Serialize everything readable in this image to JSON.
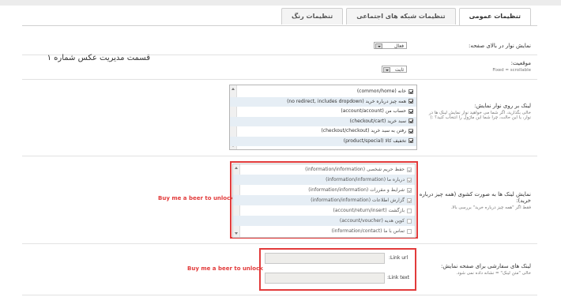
{
  "tabs": [
    {
      "label": "تنظیمات عمومی",
      "active": true
    },
    {
      "label": "تنظیمات شبکه های اجتماعی",
      "active": false
    },
    {
      "label": "تنظیمات رنگ",
      "active": false
    }
  ],
  "settings": {
    "show_bar": {
      "label": "نمایش نوار در بالای صفحه:",
      "value": "فعال"
    },
    "position": {
      "label": "موقعیت:",
      "hint": "Fixed = scrollable",
      "value": "ثابت"
    }
  },
  "heading": "قسمت مدیریت عکس شماره ۱",
  "links": {
    "label": "لینک بر روی نوار نمایش:",
    "hint": "خالی بگذارید، اگر شما می خواهید نوار نمایش لینک ها در نوار، یا این حالت، چرا شما این ماژول را انتخاب کنید؟ :)",
    "items": [
      {
        "text": "خانه (common/home)",
        "checked": true
      },
      {
        "text": "همه چیز درباره خرید (no redirect, includes dropdown)",
        "checked": true
      },
      {
        "text": "حساب من (account/account)",
        "checked": true
      },
      {
        "text": "سبد خرید (checkout/cart)",
        "checked": true
      },
      {
        "text": "رفتن به سبد خرید (checkout/checkout)",
        "checked": true
      },
      {
        "text": "تخفیف کالا (product/special)",
        "checked": true
      }
    ]
  },
  "dropdown_links": {
    "label": "نمایش لینک ها به صورت کشوی (همه چیز درباره خرید):",
    "hint": "فقط اگر \"همه چیز درباره خرید\" بررسی بالا.",
    "promo": "Buy me a beer to unlock",
    "items": [
      {
        "text": "حفظ حریم شخصی (information/information)",
        "checked": true
      },
      {
        "text": "درباره ما (information/information)",
        "checked": true
      },
      {
        "text": "شرایط و مقررات (information/information)",
        "checked": true
      },
      {
        "text": "گزارش اطلاعات (information/information)",
        "checked": true
      },
      {
        "text": "بازگشت (account/return/insert)",
        "checked": false
      },
      {
        "text": "کوپن هدیه (account/voucher)",
        "checked": false
      },
      {
        "text": "تماس با ما (information/contact)",
        "checked": false
      }
    ]
  },
  "custom_links": {
    "label": "لینک های سفارشی برای صفحه نمایش:",
    "hint": "خالی \"متن لینک\" = نشانه داده نمی شود.",
    "promo": "Buy me a beer to unlock",
    "url_label": ":Link url",
    "text_label": ":Link text",
    "url_value": "",
    "text_value": ""
  },
  "colors": {
    "accent_red": "#e23b3b",
    "row_alt": "#e6eef5"
  }
}
